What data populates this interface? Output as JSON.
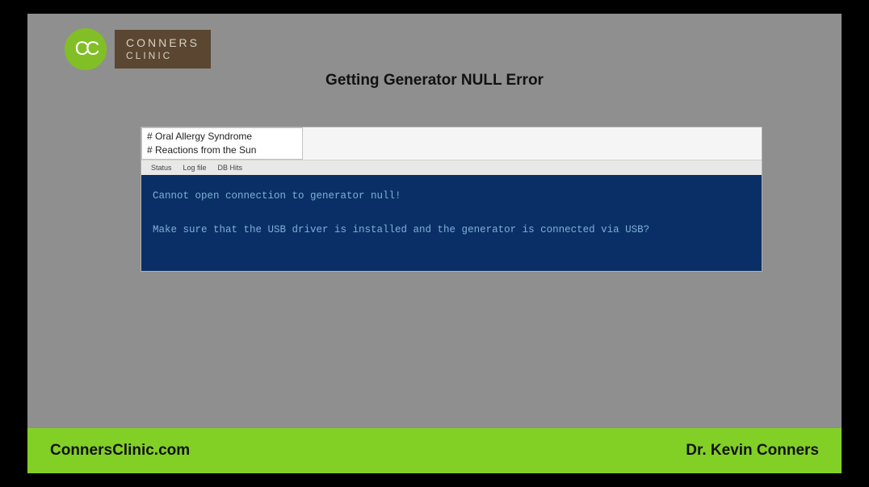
{
  "logo": {
    "cc": "CC",
    "line1": "CONNERS",
    "line2": "CLINIC"
  },
  "title": "Getting Generator NULL Error",
  "app": {
    "list_items": [
      "# Oral Allergy Syndrome",
      "# Reactions from the Sun"
    ],
    "tabs": {
      "status": "Status",
      "logfile": "Log file",
      "dbhits": "DB Hits"
    },
    "console_line1": "Cannot open connection to generator null!",
    "console_line2": "Make sure that the USB driver is installed and the generator is connected via USB?"
  },
  "footer": {
    "site": "ConnersClinic.com",
    "author": "Dr. Kevin Conners"
  }
}
